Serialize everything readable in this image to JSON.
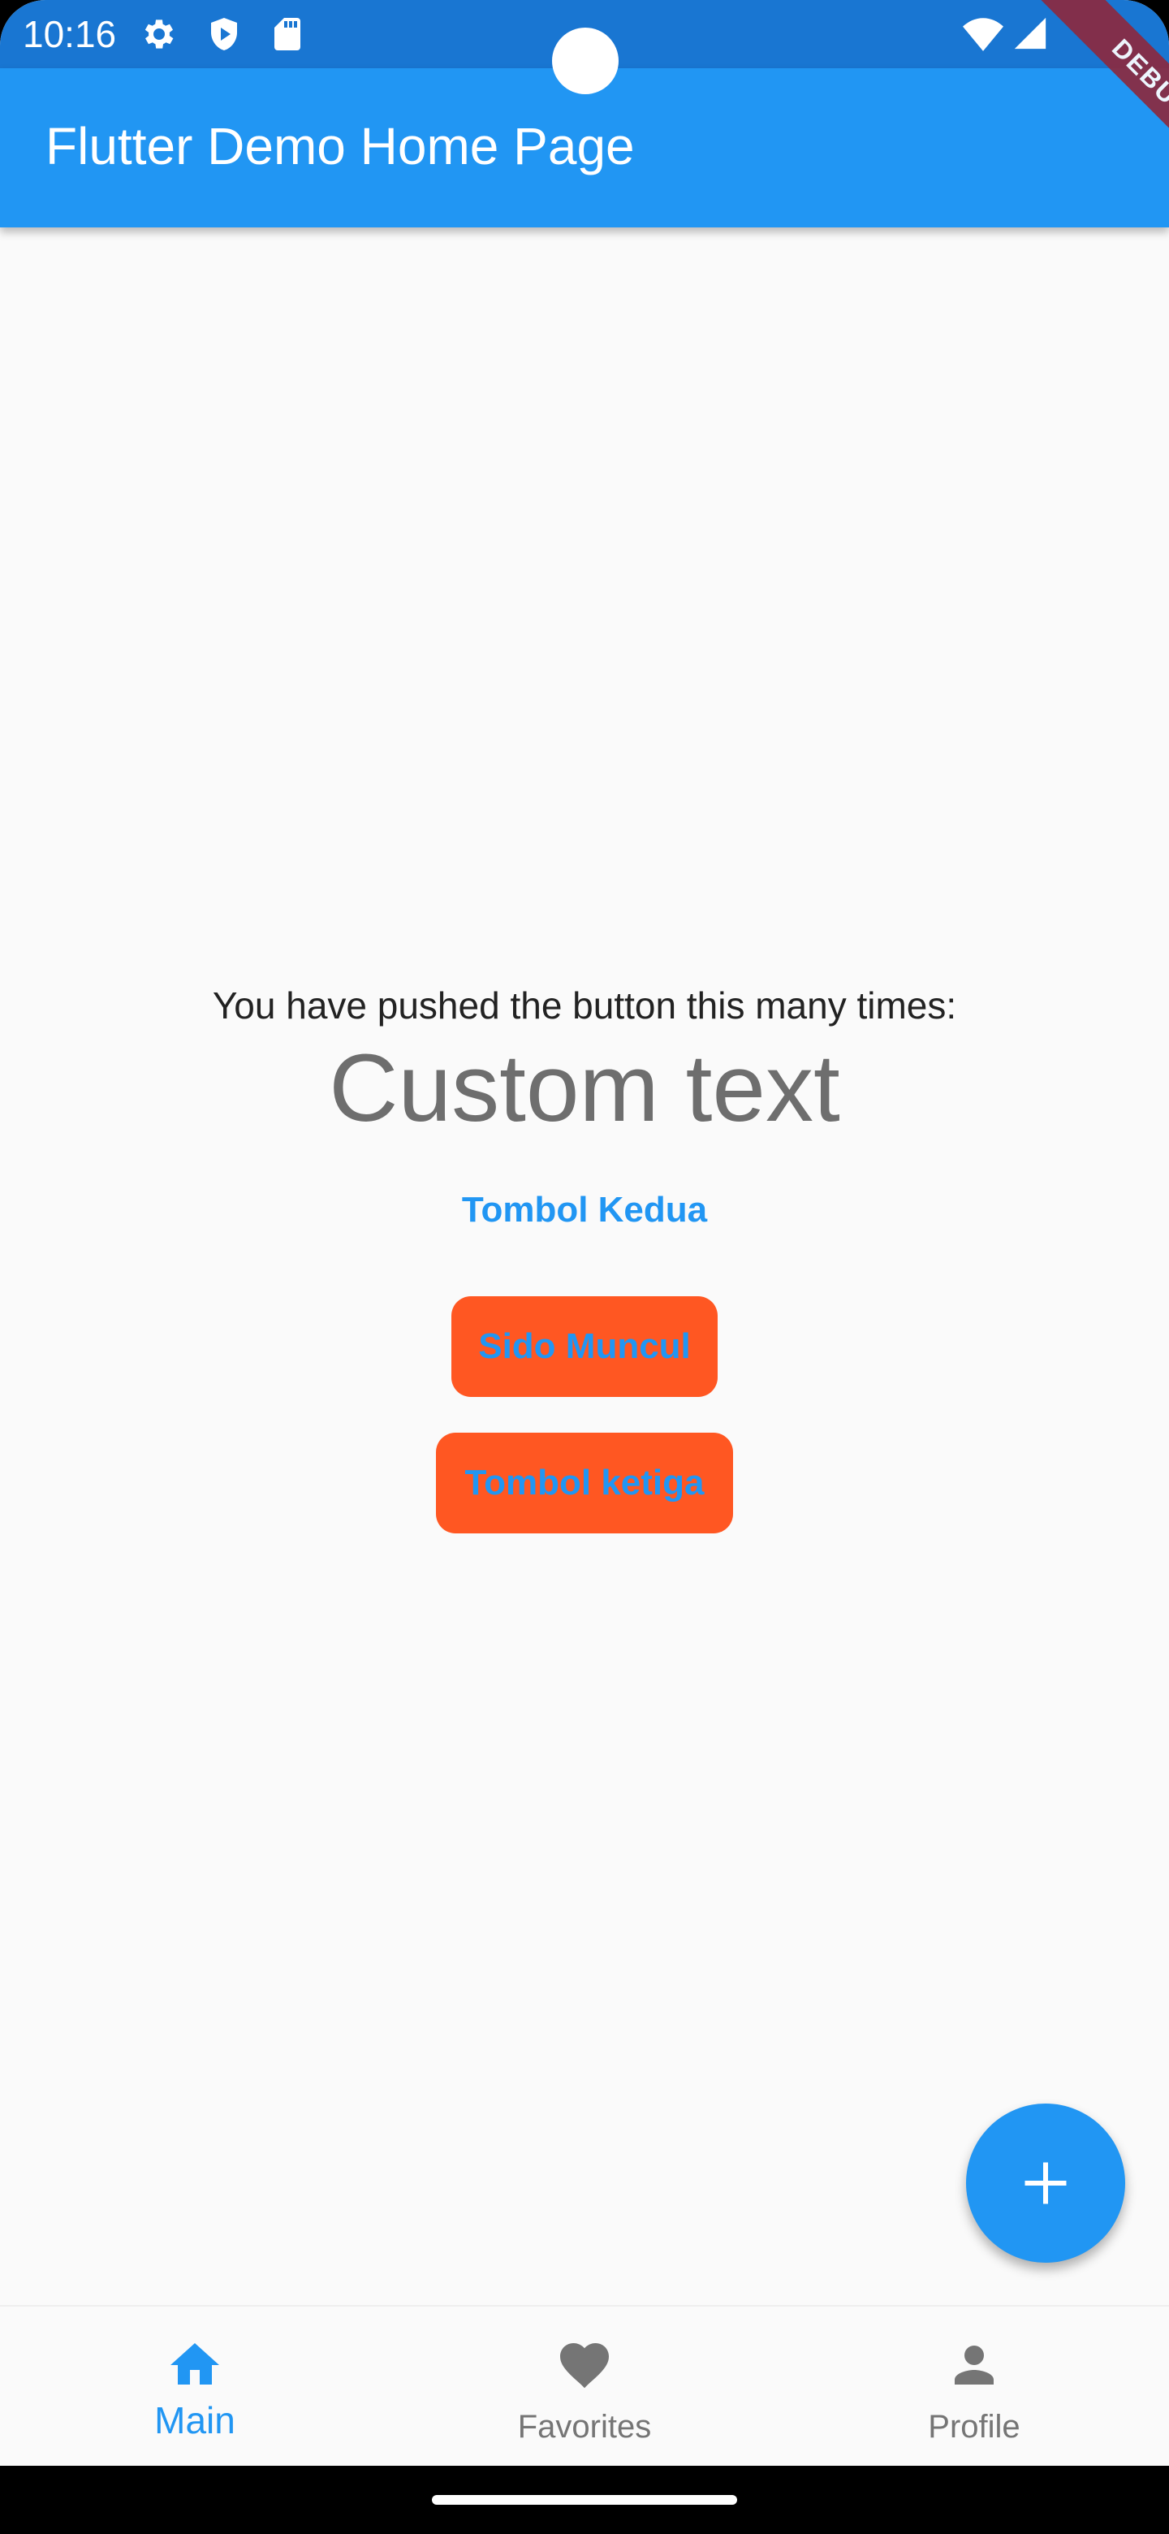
{
  "status_bar": {
    "time": "10:16",
    "icons_left": [
      "gear-icon",
      "shield-play-icon",
      "sd-card-icon"
    ],
    "icons_right": [
      "wifi-icon",
      "signal-icon"
    ]
  },
  "debug_banner": "DEBUG",
  "app_bar": {
    "title": "Flutter Demo Home Page",
    "color": "#2196f3"
  },
  "body": {
    "counter_label": "You have pushed the button this many times:",
    "counter_value": "Custom text",
    "text_button_label": "Tombol Kedua",
    "elevated_buttons": [
      "Sido Muncul",
      "Tombol ketiga"
    ],
    "button_bg_color": "#ff5722",
    "button_text_color": "#2196f3"
  },
  "fab": {
    "icon": "add-icon"
  },
  "bottom_nav": {
    "items": [
      {
        "label": "Main",
        "icon": "home-icon",
        "active": true
      },
      {
        "label": "Favorites",
        "icon": "heart-icon",
        "active": false
      },
      {
        "label": "Profile",
        "icon": "person-icon",
        "active": false
      }
    ],
    "active_color": "#2196f3",
    "inactive_color": "#757575"
  }
}
